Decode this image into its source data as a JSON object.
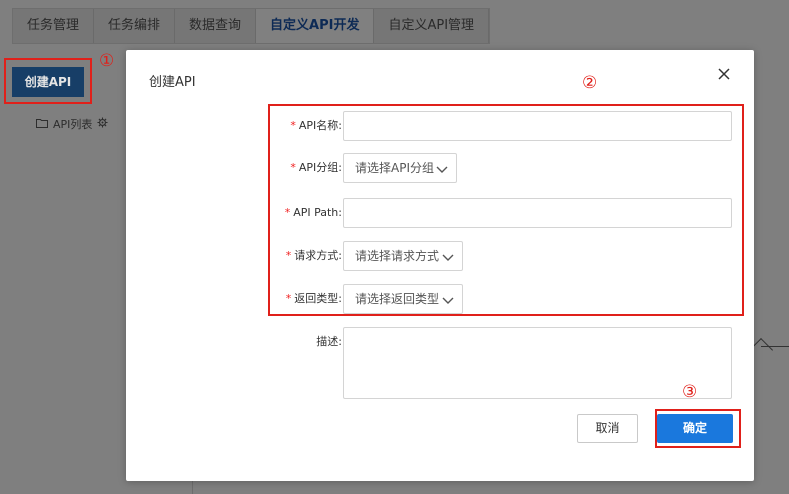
{
  "tabs": [
    {
      "label": "任务管理"
    },
    {
      "label": "任务编排"
    },
    {
      "label": "数据查询"
    },
    {
      "label": "自定义API开发"
    },
    {
      "label": "自定义API管理"
    }
  ],
  "sidebar": {
    "create_button": "创建API",
    "tree_item": "API列表"
  },
  "annotations": {
    "n1": "①",
    "n2": "②",
    "n3": "③"
  },
  "modal": {
    "title": "创建API",
    "fields": {
      "api_name": {
        "label": "API名称:",
        "value": ""
      },
      "api_group": {
        "label": "API分组:",
        "selected": "请选择API分组"
      },
      "api_path": {
        "label": "API Path:",
        "value": ""
      },
      "request_method": {
        "label": "请求方式:",
        "selected": "请选择请求方式"
      },
      "return_type": {
        "label": "返回类型:",
        "selected": "请选择返回类型"
      },
      "description": {
        "label": "描述:",
        "value": ""
      }
    },
    "required_mark": "*",
    "cancel_label": "取消",
    "confirm_label": "确定"
  },
  "colors": {
    "accent": "#1a78dd",
    "annotation": "#e0201a",
    "required": "#f02020"
  }
}
